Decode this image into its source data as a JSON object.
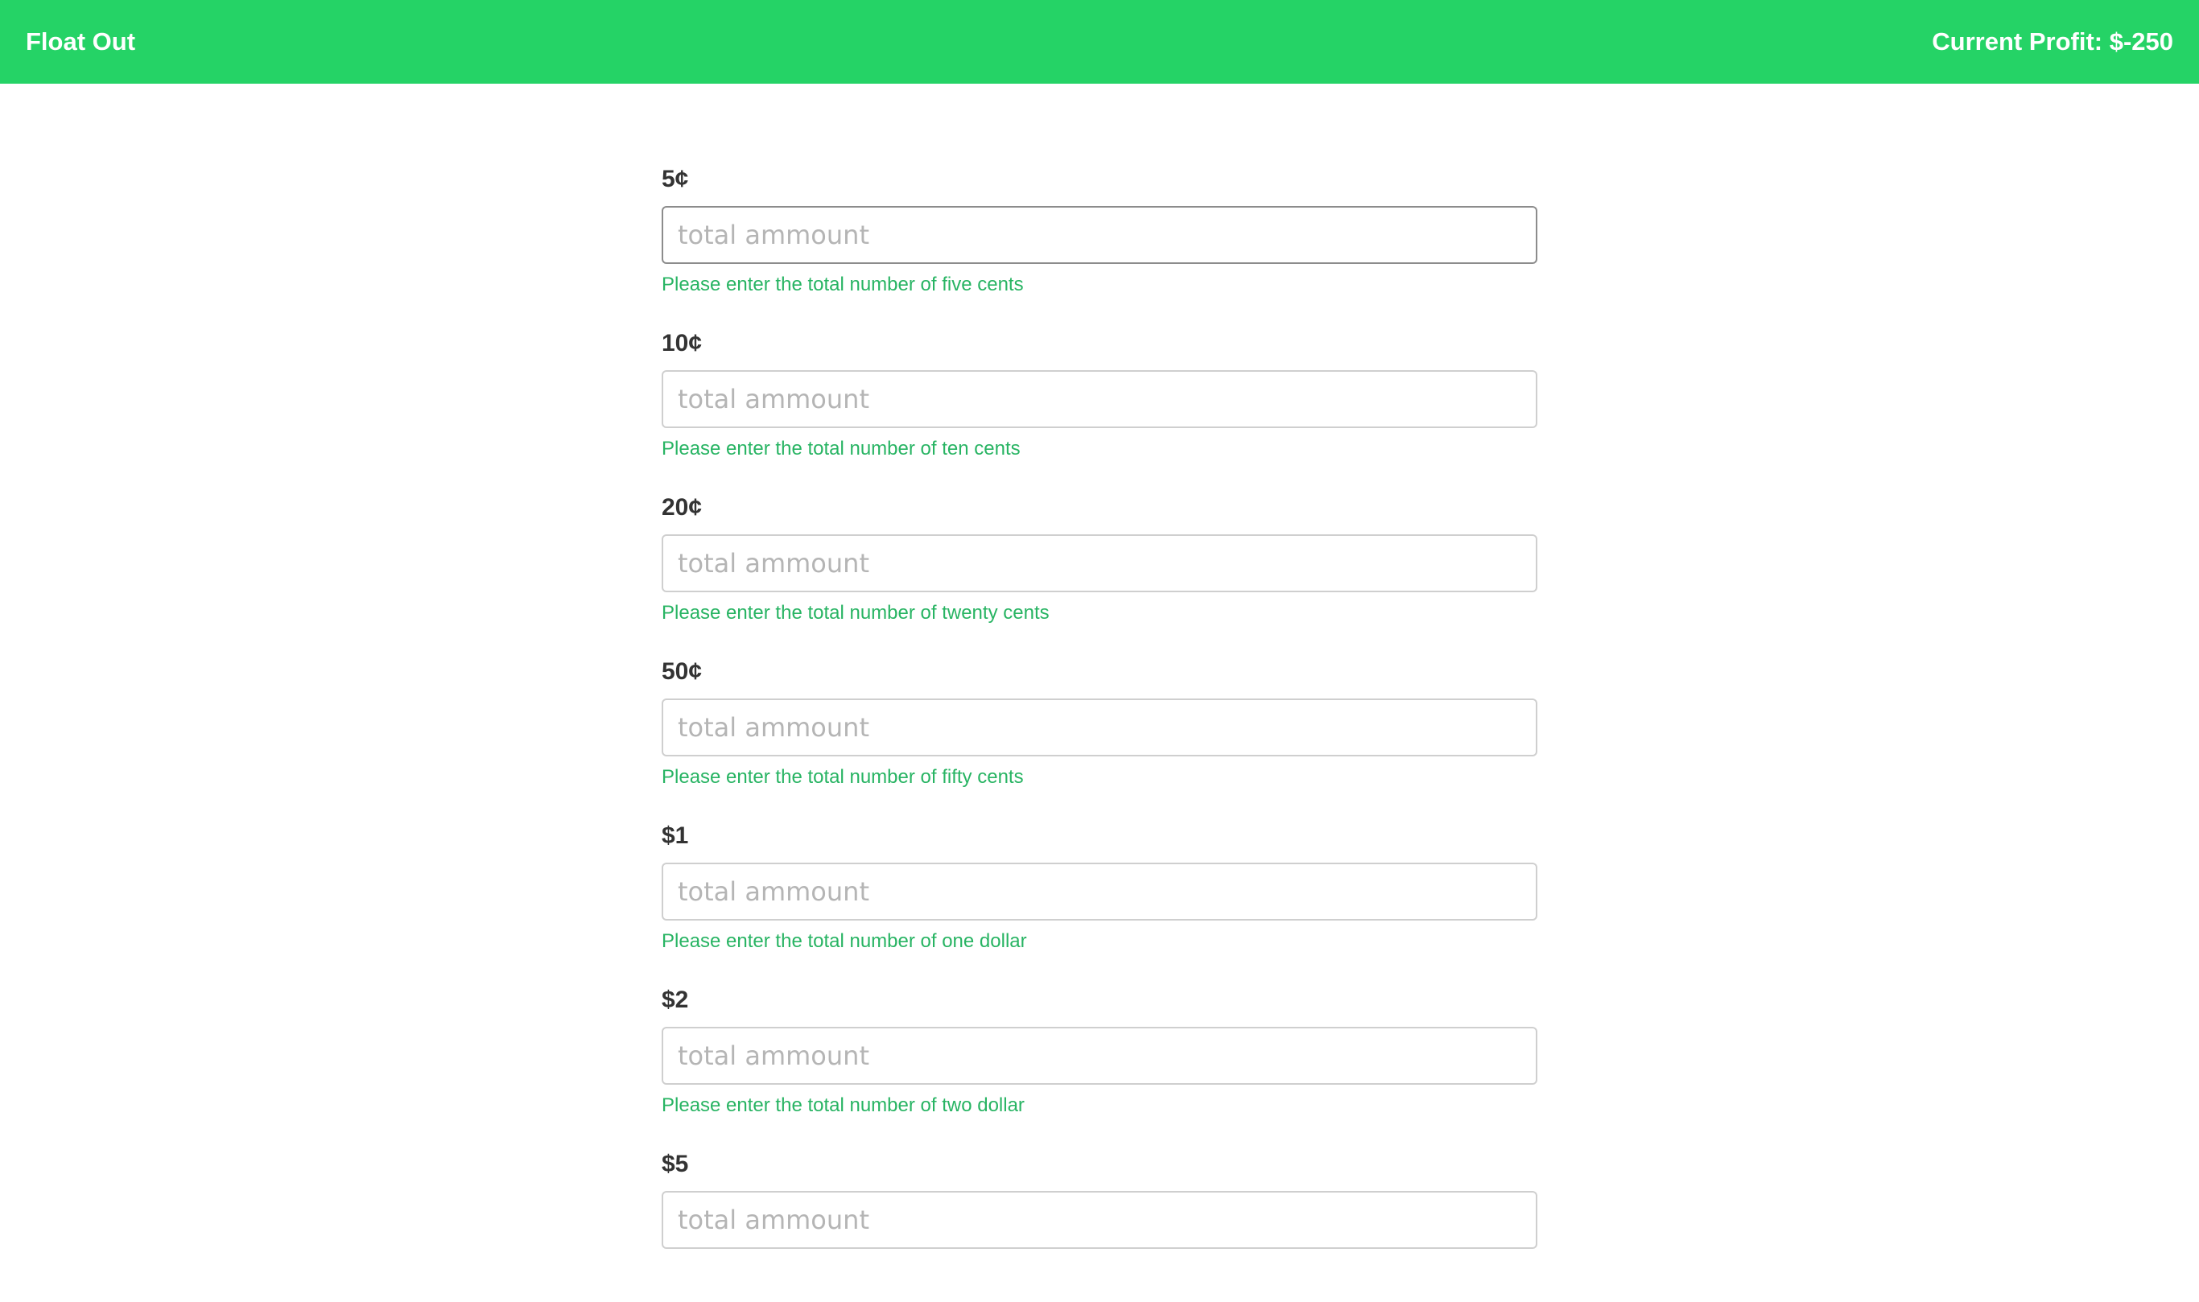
{
  "header": {
    "brand": "Float Out",
    "profit": "Current Profit: $-250",
    "background_color": "#25d366"
  },
  "form": {
    "fields": [
      {
        "label": "5¢",
        "placeholder": "total ammount",
        "value": "",
        "help": "Please enter the total number of five cents"
      },
      {
        "label": "10¢",
        "placeholder": "total ammount",
        "value": "",
        "help": "Please enter the total number of ten cents"
      },
      {
        "label": "20¢",
        "placeholder": "total ammount",
        "value": "",
        "help": "Please enter the total number of twenty cents"
      },
      {
        "label": "50¢",
        "placeholder": "total ammount",
        "value": "",
        "help": "Please enter the total number of fifty cents"
      },
      {
        "label": "$1",
        "placeholder": "total ammount",
        "value": "",
        "help": "Please enter the total number of one dollar"
      },
      {
        "label": "$2",
        "placeholder": "total ammount",
        "value": "",
        "help": "Please enter the total number of two dollar"
      },
      {
        "label": "$5",
        "placeholder": "total ammount",
        "value": ""
      }
    ],
    "help_text_color": "#28b463"
  }
}
